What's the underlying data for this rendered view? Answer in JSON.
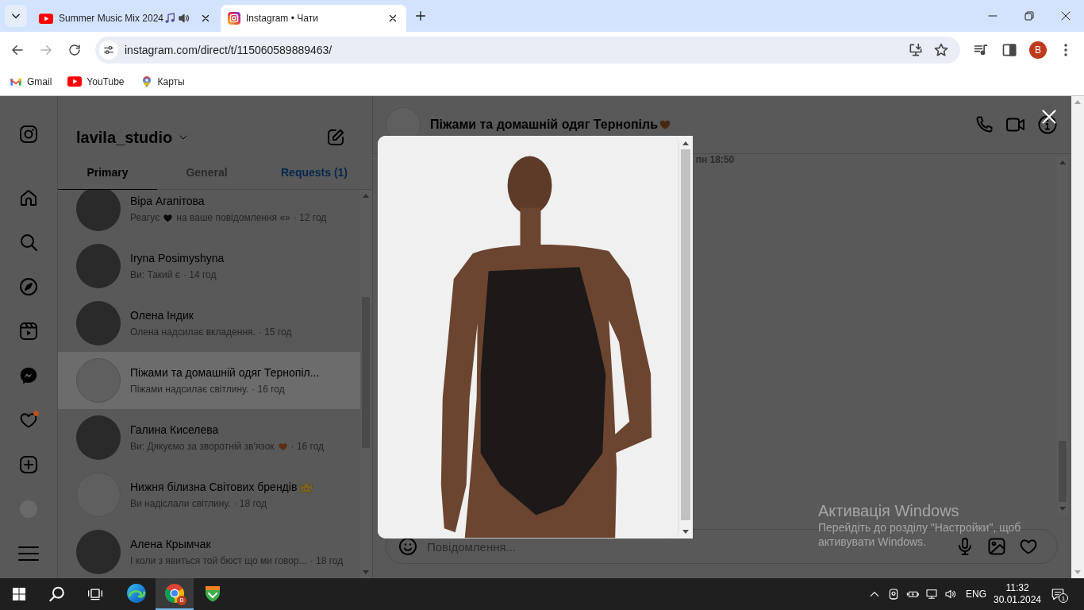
{
  "browser": {
    "tabs": [
      {
        "title": "Summer Music Mix 2024",
        "kind": "youtube",
        "selected": false,
        "playing": true
      },
      {
        "title": "Instagram • Чати",
        "kind": "instagram",
        "selected": true,
        "playing": false
      }
    ],
    "nav_buttons": [
      {
        "kind": "back",
        "disabled": false
      },
      {
        "kind": "forward",
        "disabled": true
      },
      {
        "kind": "reload",
        "disabled": false
      }
    ],
    "address": "instagram.com/direct/t/115060589889463/",
    "profile": "B",
    "bookmarks": [
      {
        "label": "Gmail",
        "kind": "gmail"
      },
      {
        "label": "YouTube",
        "kind": "youtube"
      },
      {
        "label": "Карты",
        "kind": "maps"
      }
    ]
  },
  "sidebar": {
    "items": [
      {
        "kind": "logo",
        "selected": false,
        "unread": false
      },
      {
        "kind": "home",
        "selected": false,
        "unread": false
      },
      {
        "kind": "search",
        "selected": false,
        "unread": false
      },
      {
        "kind": "explore",
        "selected": false,
        "unread": false
      },
      {
        "kind": "reels",
        "selected": false,
        "unread": false
      },
      {
        "kind": "messages",
        "selected": true,
        "unread": false
      },
      {
        "kind": "notifications",
        "selected": false,
        "unread": true
      },
      {
        "kind": "create",
        "selected": false,
        "unread": false
      },
      {
        "kind": "profile",
        "selected": false,
        "unread": false
      },
      {
        "kind": "more",
        "selected": false,
        "unread": false
      }
    ]
  },
  "inbox": {
    "account": "lavila_studio",
    "tabs": [
      {
        "label": "Primary",
        "kind": "tab",
        "selected": true
      },
      {
        "label": "General",
        "kind": "tab",
        "selected": false
      },
      {
        "label": "Requests (1)",
        "kind": "link",
        "selected": false
      }
    ],
    "chats": [
      {
        "name": "Віра Агапітова",
        "avatar": {
          "kind": "photo"
        },
        "preview": [
          {
            "kind": "text",
            "text": "Реагує"
          },
          {
            "kind": "heart",
            "color": "#0a0a0a"
          },
          {
            "kind": "text",
            "text": "на ваше повідомлення «»"
          }
        ],
        "time": "· 12 год",
        "selected": false
      },
      {
        "name": "Iryna Posimyshyna",
        "avatar": {
          "kind": "photo"
        },
        "preview": [
          {
            "kind": "text",
            "text": "Ви: Такий є"
          }
        ],
        "time": "· 14 год",
        "selected": false
      },
      {
        "name": "Олена Індик",
        "avatar": {
          "kind": "photo"
        },
        "preview": [
          {
            "kind": "text",
            "text": "Олена надсилає вкладення."
          }
        ],
        "time": "· 15 год",
        "selected": false
      },
      {
        "name": "Піжами та домашній одяг Тернопіл...",
        "avatar": {
          "kind": "logo"
        },
        "preview": [
          {
            "kind": "text",
            "text": "Піжами надсилає світлину."
          }
        ],
        "time": "· 16 год",
        "selected": true
      },
      {
        "name": "Галина Киселева",
        "avatar": {
          "kind": "photo"
        },
        "preview": [
          {
            "kind": "text",
            "text": "Ви: Дякуємо за зворотній зв'язок"
          },
          {
            "kind": "heart",
            "color": "#5a2f12"
          }
        ],
        "time": "· 16 год",
        "selected": false
      },
      {
        "name": "Нижня білизна Світових брендів",
        "emoji": {
          "kind": "crown"
        },
        "avatar": {
          "kind": "logo"
        },
        "preview": [
          {
            "kind": "text",
            "text": "Ви надіслали світлину."
          }
        ],
        "time": "· 18 год",
        "selected": false
      },
      {
        "name": "Алена Крымчак",
        "avatar": {
          "kind": "photo"
        },
        "preview": [
          {
            "kind": "text",
            "text": "І коли з явиться той бюст що ми говор..."
          }
        ],
        "time": "· 18 год",
        "selected": false
      }
    ]
  },
  "chat": {
    "title": "Піжами та домашній одяг Тернопіль",
    "title_emoji": {
      "kind": "heart",
      "color": "#4a2810"
    },
    "actions": [
      {
        "kind": "call"
      },
      {
        "kind": "video"
      },
      {
        "kind": "info"
      }
    ],
    "timestamp": "пн 18:50",
    "composer": {
      "placeholder": "Повідомлення...",
      "actions": [
        {
          "kind": "voice"
        },
        {
          "kind": "photo"
        },
        {
          "kind": "like"
        }
      ]
    }
  },
  "activation": {
    "title": "Активація Windows",
    "lines": [
      "Перейдіть до розділу \"Настройки\", щоб",
      "активувати Windows."
    ]
  },
  "taskbar": {
    "buttons": [
      {
        "kind": "start"
      },
      {
        "kind": "search"
      },
      {
        "kind": "taskview"
      }
    ],
    "apps": [
      {
        "kind": "edge",
        "selected": false
      },
      {
        "kind": "chrome",
        "selected": true,
        "badge": "B"
      },
      {
        "kind": "shield",
        "selected": false
      }
    ],
    "tray": [
      {
        "kind": "chevron"
      },
      {
        "kind": "meet"
      },
      {
        "kind": "power"
      },
      {
        "kind": "network"
      },
      {
        "kind": "volume"
      }
    ],
    "language": "ENG",
    "time": "11:32",
    "date": "30.01.2024",
    "notifications": "1"
  }
}
